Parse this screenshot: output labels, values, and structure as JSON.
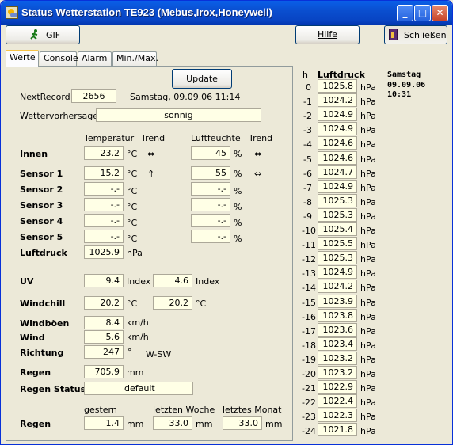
{
  "window": {
    "title": "Status Wetterstation TE923 (Mebus,Irox,Honeywell)",
    "minimize": "_",
    "maximize": "□",
    "close": "✕"
  },
  "toolbar": {
    "gif_label": "GIF",
    "help_label": "Hilfe",
    "close_label": "Schließen"
  },
  "tabs": [
    {
      "label": "Werte"
    },
    {
      "label": "Console"
    },
    {
      "label": "Alarm"
    },
    {
      "label": "Min./Max."
    }
  ],
  "update_label": "Update",
  "next_record": {
    "label": "NextRecord",
    "value": "2656",
    "timestamp": "Samstag, 09.09.06  11:14"
  },
  "forecast": {
    "label": "Wettervorhersage",
    "value": "sonnig"
  },
  "headers": {
    "temp": "Temperatur",
    "trend": "Trend",
    "humidity": "Luftfeuchte",
    "trend2": "Trend"
  },
  "units": {
    "celsius": "°C",
    "percent": "%",
    "hpa": "hPa",
    "index": "Index",
    "kmh": "km/h",
    "deg": "°",
    "mm": "mm",
    "celsius2": "°C"
  },
  "sensors": [
    {
      "name": "Innen",
      "temp": "23.2",
      "temp_trend": "⇔",
      "hum": "45",
      "hum_trend": "⇔"
    },
    {
      "name": "Sensor 1",
      "temp": "15.2",
      "temp_trend": "⇑",
      "hum": "55",
      "hum_trend": "⇔"
    },
    {
      "name": "Sensor 2",
      "temp": "-.-",
      "temp_trend": "",
      "hum": "-.-",
      "hum_trend": ""
    },
    {
      "name": "Sensor 3",
      "temp": "-.-",
      "temp_trend": "",
      "hum": "-.-",
      "hum_trend": ""
    },
    {
      "name": "Sensor 4",
      "temp": "-.-",
      "temp_trend": "",
      "hum": "-.-",
      "hum_trend": ""
    },
    {
      "name": "Sensor 5",
      "temp": "-.-",
      "temp_trend": "",
      "hum": "-.-",
      "hum_trend": ""
    }
  ],
  "pressure": {
    "label": "Luftdruck",
    "value": "1025.9"
  },
  "uv": {
    "label": "UV",
    "value": "9.4",
    "value2": "4.6"
  },
  "windchill": {
    "label": "Windchill",
    "value": "20.2",
    "value2": "20.2"
  },
  "gust": {
    "label": "Windböen",
    "value": "8.4"
  },
  "wind": {
    "label": "Wind",
    "value": "5.6"
  },
  "direction": {
    "label": "Richtung",
    "value": "247",
    "text": "W-SW"
  },
  "rain": {
    "label": "Regen",
    "value": "705.9"
  },
  "rain_status": {
    "label": "Regen Status",
    "value": "default"
  },
  "rain_hist": {
    "label": "Regen",
    "yesterday_label": "gestern",
    "week_label": "letzten Woche",
    "month_label": "letztes Monat",
    "yesterday": "1.4",
    "week": "33.0",
    "month": "33.0"
  },
  "history": {
    "h_label": "h",
    "title": "Luftdruck",
    "day": "Samstag",
    "date": "09.09.06",
    "time": "10:31",
    "unit": "hPa",
    "rows": [
      {
        "h": "0",
        "v": "1025.8"
      },
      {
        "h": "-1",
        "v": "1024.2"
      },
      {
        "h": "-2",
        "v": "1024.9"
      },
      {
        "h": "-3",
        "v": "1024.9"
      },
      {
        "h": "-4",
        "v": "1024.6"
      },
      {
        "h": "-5",
        "v": "1024.6"
      },
      {
        "h": "-6",
        "v": "1024.7"
      },
      {
        "h": "-7",
        "v": "1024.9"
      },
      {
        "h": "-8",
        "v": "1025.3"
      },
      {
        "h": "-9",
        "v": "1025.3"
      },
      {
        "h": "-10",
        "v": "1025.4"
      },
      {
        "h": "-11",
        "v": "1025.5"
      },
      {
        "h": "-12",
        "v": "1025.3"
      },
      {
        "h": "-13",
        "v": "1024.9"
      },
      {
        "h": "-14",
        "v": "1024.2"
      },
      {
        "h": "-15",
        "v": "1023.9"
      },
      {
        "h": "-16",
        "v": "1023.8"
      },
      {
        "h": "-17",
        "v": "1023.6"
      },
      {
        "h": "-18",
        "v": "1023.4"
      },
      {
        "h": "-19",
        "v": "1023.2"
      },
      {
        "h": "-20",
        "v": "1023.2"
      },
      {
        "h": "-21",
        "v": "1022.9"
      },
      {
        "h": "-22",
        "v": "1022.4"
      },
      {
        "h": "-23",
        "v": "1022.3"
      },
      {
        "h": "-24",
        "v": "1021.8"
      }
    ]
  }
}
